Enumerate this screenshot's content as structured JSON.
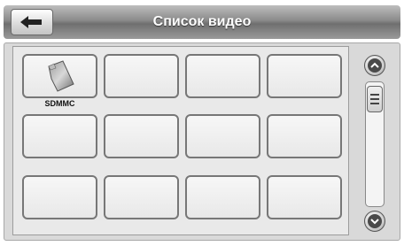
{
  "header": {
    "title": "Список видео"
  },
  "grid": {
    "items": [
      {
        "label": "SDMMC",
        "icon": "sd-card-icon"
      },
      {
        "label": ""
      },
      {
        "label": ""
      },
      {
        "label": ""
      },
      {
        "label": ""
      },
      {
        "label": ""
      },
      {
        "label": ""
      },
      {
        "label": ""
      },
      {
        "label": ""
      },
      {
        "label": ""
      },
      {
        "label": ""
      },
      {
        "label": ""
      }
    ]
  },
  "scrollbar": {
    "up_icon": "chevron-up-icon",
    "down_icon": "chevron-down-icon",
    "position": 0
  }
}
